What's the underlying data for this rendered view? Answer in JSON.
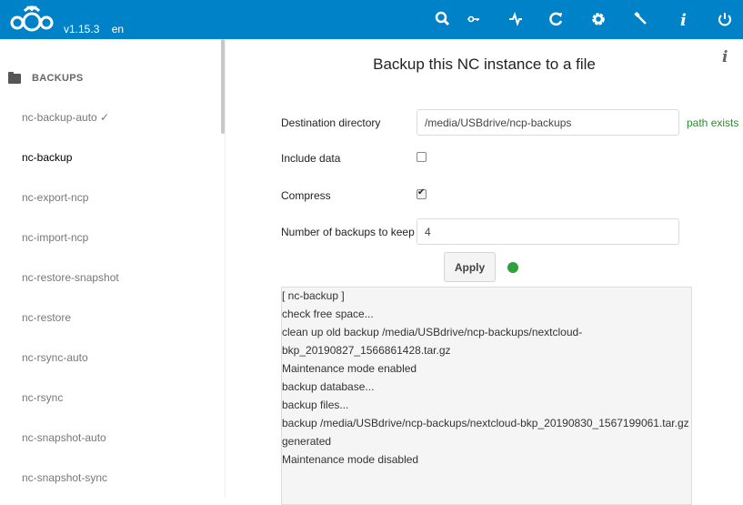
{
  "header": {
    "version": "v1.15.3",
    "language": "en",
    "icons": [
      "search-icon",
      "key-icon",
      "activity-icon",
      "refresh-icon",
      "gear-icon",
      "wrench-icon",
      "info-icon",
      "power-icon"
    ]
  },
  "sidebar": {
    "section_label": "BACKUPS",
    "items": [
      {
        "label": "nc-backup-auto ✓"
      },
      {
        "label": "nc-backup"
      },
      {
        "label": "nc-export-ncp"
      },
      {
        "label": "nc-import-ncp"
      },
      {
        "label": "nc-restore-snapshot"
      },
      {
        "label": "nc-restore"
      },
      {
        "label": "nc-rsync-auto"
      },
      {
        "label": "nc-rsync"
      },
      {
        "label": "nc-snapshot-auto"
      },
      {
        "label": "nc-snapshot-sync"
      }
    ]
  },
  "main": {
    "title": "Backup this NC instance to a file",
    "info_glyph": "i",
    "form": {
      "destination_label": "Destination directory",
      "destination_value": "/media/USBdrive/ncp-backups",
      "destination_status": "path exists",
      "include_data_label": "Include data",
      "include_data_checked": false,
      "compress_label": "Compress",
      "compress_checked": true,
      "keep_label": "Number of backups to keep",
      "keep_value": "4",
      "apply_label": "Apply",
      "status_color": "#30a13a"
    },
    "output_lines": [
      "[ nc-backup ]",
      "check free space...",
      "clean up old backup /media/USBdrive/ncp-backups/nextcloud-",
      "bkp_20190827_1566861428.tar.gz",
      "Maintenance mode enabled",
      "backup database...",
      "backup files...",
      "backup /media/USBdrive/ncp-backups/nextcloud-bkp_20190830_1567199061.tar.gz",
      "generated",
      "Maintenance mode disabled"
    ]
  },
  "colors": {
    "topbar": "#0082c9",
    "ok": "#2e8b2e"
  }
}
